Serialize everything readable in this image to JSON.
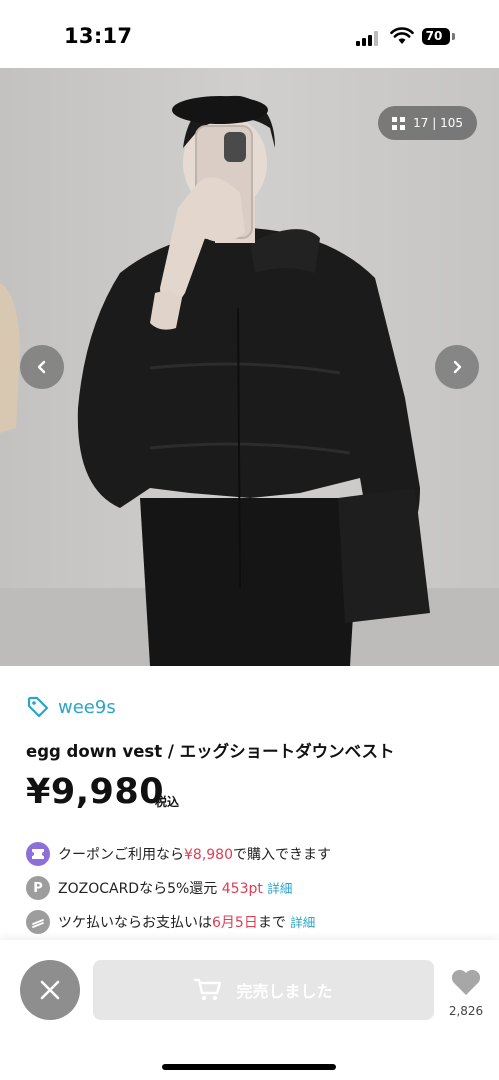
{
  "status_bar": {
    "time": "13:17",
    "battery": "70"
  },
  "gallery": {
    "counter": "17 | 105"
  },
  "product": {
    "brand": "wee9s",
    "title": "egg down vest / エッグショートダウンベスト",
    "price": "¥9,980",
    "tax_label": "税込"
  },
  "promos": {
    "coupon": {
      "prefix": "クーポンご利用なら",
      "price": "¥8,980",
      "suffix": "で購入できます"
    },
    "zozocard": {
      "icon": "P",
      "prefix": "ZOZOCARDなら5%還元",
      "points": "453pt",
      "link": "詳細"
    },
    "tsuke": {
      "prefix": "ツケ払いならお支払いは",
      "date": "6月5日",
      "suffix": "まで",
      "link": "詳細"
    }
  },
  "actions": {
    "cart_label": "完売しました",
    "favorite_count": "2,826"
  },
  "colors": {
    "accent": "#2aa5c9",
    "sale": "#e03c52",
    "coupon_icon": "#8e6fd8",
    "disabled": "#e6e6e6"
  },
  "icons": [
    "tag-icon",
    "grid-icon",
    "chevron-left-icon",
    "chevron-right-icon",
    "coupon-icon",
    "zozocard-icon",
    "tsuke-icon",
    "close-icon",
    "cart-icon",
    "heart-icon"
  ]
}
